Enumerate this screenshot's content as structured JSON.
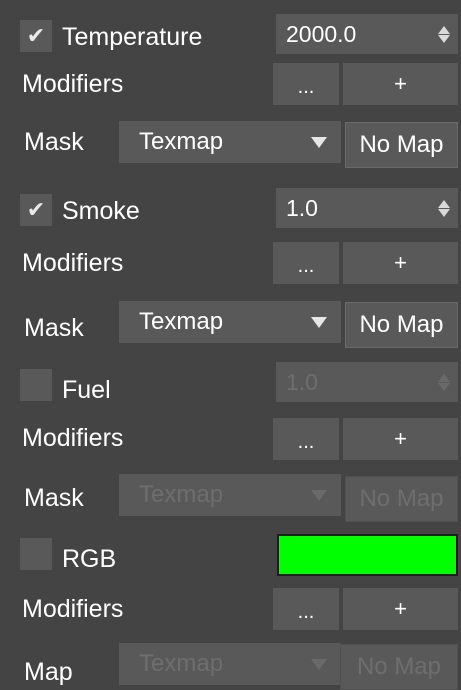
{
  "temperature": {
    "checked": true,
    "check_glyph": "✔",
    "label": "Temperature",
    "value": "2000.0",
    "modifiers_label": "Modifiers",
    "dots_label": "...",
    "plus_label": "+",
    "mask_label": "Mask",
    "texmap_label": "Texmap",
    "nomap_label": "No Map"
  },
  "smoke": {
    "checked": true,
    "check_glyph": "✔",
    "label": "Smoke",
    "value": "1.0",
    "modifiers_label": "Modifiers",
    "dots_label": "...",
    "plus_label": "+",
    "mask_label": "Mask",
    "texmap_label": "Texmap",
    "nomap_label": "No Map"
  },
  "fuel": {
    "checked": false,
    "label": "Fuel",
    "value": "1.0",
    "modifiers_label": "Modifiers",
    "dots_label": "...",
    "plus_label": "+",
    "mask_label": "Mask",
    "texmap_label": "Texmap",
    "nomap_label": "No Map"
  },
  "rgb": {
    "checked": false,
    "label": "RGB",
    "color": "#00ff00",
    "modifiers_label": "Modifiers",
    "dots_label": "...",
    "plus_label": "+",
    "map_label": "Map",
    "texmap_label": "Texmap",
    "nomap_label": "No Map"
  },
  "colors": {
    "panel_bg": "#444444",
    "control_bg": "#595959",
    "disabled_text": "#6e6e6e",
    "text": "#ffffff"
  }
}
